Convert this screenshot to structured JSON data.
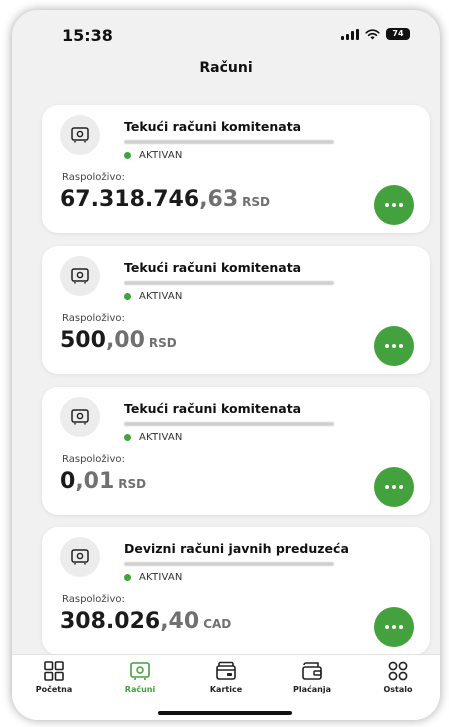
{
  "status_bar": {
    "time": "15:38",
    "battery": "74"
  },
  "header": {
    "title": "Računi"
  },
  "accounts": [
    {
      "name": "Tekući računi komitenata",
      "status": "AKTIVAN",
      "available_label": "Raspoloživo:",
      "balance_int": "67.318.746",
      "balance_dec": ",63",
      "currency": "RSD"
    },
    {
      "name": "Tekući računi komitenata",
      "status": "AKTIVAN",
      "available_label": "Raspoloživo:",
      "balance_int": "500",
      "balance_dec": ",00",
      "currency": "RSD"
    },
    {
      "name": "Tekući računi komitenata",
      "status": "AKTIVAN",
      "available_label": "Raspoloživo:",
      "balance_int": "0",
      "balance_dec": ",01",
      "currency": "RSD"
    },
    {
      "name": "Devizni računi javnih preduzeća",
      "status": "AKTIVAN",
      "available_label": "Raspoloživo:",
      "balance_int": "308.026",
      "balance_dec": ",40",
      "currency": "CAD"
    }
  ],
  "tabbar": {
    "items": [
      {
        "label": "Početna",
        "icon": "grid-icon"
      },
      {
        "label": "Računi",
        "icon": "safe-icon",
        "active": true
      },
      {
        "label": "Kartice",
        "icon": "cards-icon"
      },
      {
        "label": "Plaćanja",
        "icon": "wallet-icon"
      },
      {
        "label": "Ostalo",
        "icon": "more-circles-icon"
      }
    ]
  },
  "colors": {
    "accent": "#43a23d",
    "background": "#f1f1f1",
    "card": "#ffffff"
  }
}
